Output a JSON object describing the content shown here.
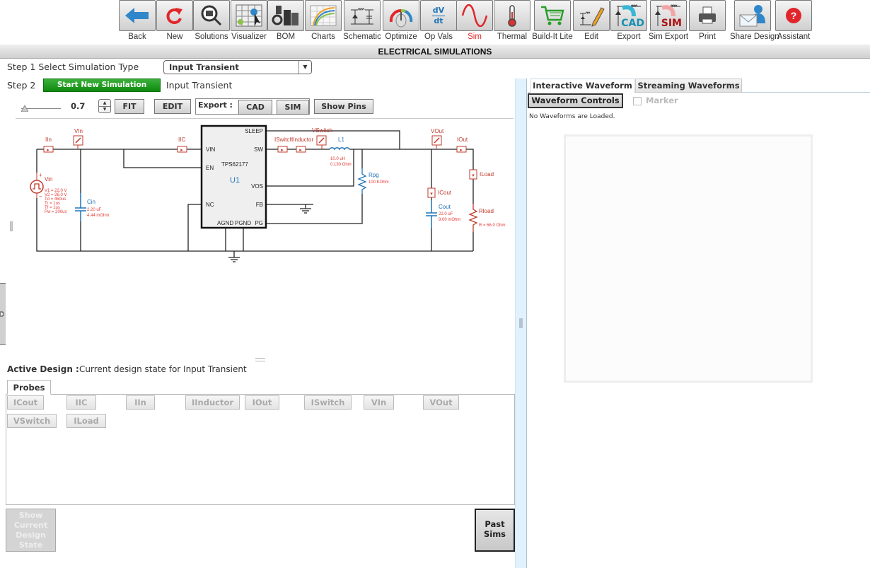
{
  "toolbar": {
    "items": [
      {
        "label": "Back",
        "icon": "back-arrow-icon"
      },
      {
        "label": "New",
        "icon": "refresh-icon"
      },
      {
        "label": "Solutions",
        "icon": "magnifier-chip-icon"
      },
      {
        "label": "Visualizer",
        "icon": "visualizer-grid-icon"
      },
      {
        "label": "BOM",
        "icon": "components-icon"
      },
      {
        "label": "Charts",
        "icon": "curves-chart-icon"
      },
      {
        "label": "Schematic",
        "icon": "schematic-icon"
      },
      {
        "label": "Optimize",
        "icon": "gauge-dial-icon"
      },
      {
        "label": "Op Vals",
        "icon": "dv-dt-icon"
      },
      {
        "label": "Sim",
        "icon": "sine-wave-icon",
        "active": true
      },
      {
        "label": "Thermal",
        "icon": "thermometer-icon"
      },
      {
        "label": "Build-It Lite",
        "icon": "shopping-cart-icon"
      },
      {
        "label": "Edit",
        "icon": "pencil-schematic-icon"
      },
      {
        "label": "Export",
        "icon": "cad-export-icon"
      },
      {
        "label": "Sim Export",
        "icon": "sim-export-icon"
      },
      {
        "label": "Print",
        "icon": "printer-icon"
      },
      {
        "label": "Share Design",
        "icon": "envelope-user-icon"
      },
      {
        "label": "Assistant",
        "icon": "help-question-icon"
      }
    ],
    "dvdt_top": "dV",
    "dvdt_bottom": "dt",
    "cad_text": "CAD",
    "sim_text": "SIM"
  },
  "title": "ELECTRICAL SIMULATIONS",
  "step1": {
    "label": "Step 1 Select Simulation Type",
    "selected": "Input Transient"
  },
  "step2": {
    "label": "Step 2",
    "button": "Start New Simulation",
    "status": "Input Transient"
  },
  "controls": {
    "zoom_value": "0.7",
    "fit": "FIT",
    "edit": "EDIT",
    "export_label": "Export :",
    "cad": "CAD",
    "sim": "SIM",
    "show_pins": "Show Pins"
  },
  "schematic": {
    "ic": {
      "part": "TPS62177",
      "ref": "U1",
      "pins": {
        "sleep": "SLEEP",
        "vin": "VIN",
        "sw": "SW",
        "en": "EN",
        "vos": "VOS",
        "nc": "NC",
        "fb": "FB",
        "agnd": "AGND",
        "pgnd": "PGND",
        "pg": "PG"
      }
    },
    "probes": {
      "iin": "IIn",
      "vin": "VIn",
      "iic": "IIC",
      "iswitch": "ISwitch",
      "iinductor": "IInductor",
      "vswitch": "VSwitch",
      "vout": "VOut",
      "iout": "IOut",
      "iload": "ILoad",
      "icout": "ICout"
    },
    "source": {
      "name": "Vin",
      "params": [
        "V1 = 22.0 V",
        "V2 = 26.0 V",
        "Td = 450us",
        "Tr = 1us",
        "Tf = 1us",
        "Pw = 200us"
      ]
    },
    "cin": {
      "name": "Cin",
      "value": "2.20 uF",
      "esr": "4.44 mOhm"
    },
    "l1": {
      "name": "L1",
      "value": "10.0 uH",
      "dcr": "0.130 Ohm"
    },
    "rpg": {
      "name": "Rpg",
      "value": "100 KOhm"
    },
    "cout": {
      "name": "Cout",
      "value": "22.0 uF",
      "esr": "9.00 mOhm"
    },
    "rload": {
      "name": "Rload",
      "value": "R = 66.0 Ohm"
    }
  },
  "active_design": {
    "label": "Active Design :",
    "value": "Current design state for Input Transient"
  },
  "probes_tab": "Probes",
  "probe_buttons": [
    "ICout",
    "IIC",
    "IIn",
    "IInductor",
    "IOut",
    "ISwitch",
    "VIn",
    "VOut",
    "VSwitch",
    "ILoad"
  ],
  "show_current_design_state": "Show Current Design State",
  "past_sims": "Past Sims",
  "right": {
    "tabs": [
      "Interactive Waveform",
      "Streaming Waveforms"
    ],
    "waveform_controls": "Waveform Controls",
    "marker": "Marker",
    "marker_checked": false,
    "status": "No Waveforms are Loaded."
  },
  "colors": {
    "accent_green": "#0d8a0d",
    "schematic_red": "#d9322f",
    "schematic_blue": "#1f73b7",
    "active_tab_red": "#e0262b"
  }
}
